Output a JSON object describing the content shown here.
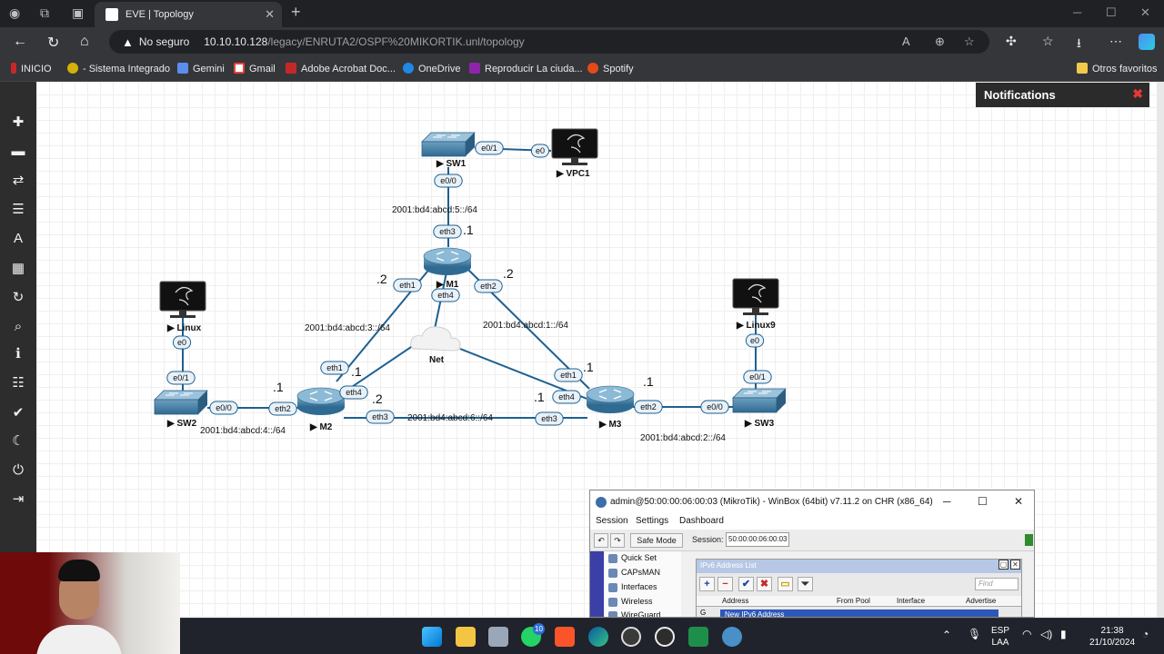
{
  "browser": {
    "tab_title": "EVE | Topology",
    "url_insecure": "No seguro",
    "url_host": "10.10.10.128",
    "url_path": "/legacy/ENRUTA2/OSPF%20MIKORTIK.unl/topology",
    "bookmarks": [
      "INICIO",
      "- Sistema Integrado",
      "Gemini",
      "Gmail",
      "Adobe Acrobat Doc...",
      "OneDrive",
      "Reproducir La ciuda...",
      "Spotify"
    ],
    "other_favorites": "Otros favoritos"
  },
  "notifications": {
    "title": "Notifications"
  },
  "topology": {
    "nodes": {
      "sw1": "SW1",
      "vpc1": "VPC1",
      "m1": "M1",
      "m2": "M2",
      "m3": "M3",
      "sw2": "SW2",
      "sw3": "SW3",
      "linux": "Linux",
      "linux9": "Linux9",
      "net": "Net"
    },
    "ports": {
      "sw1_e01": "e0/1",
      "vpc1_e0": "e0",
      "sw1_e00": "e0/0",
      "m1_eth3": "eth3",
      "m1_eth1": "eth1",
      "m1_eth4": "eth4",
      "m1_eth2": "eth2",
      "m2_eth1": "eth1",
      "m2_eth4": "eth4",
      "m2_eth2": "eth2",
      "m2_eth3": "eth3",
      "m3_eth1": "eth1",
      "m3_eth4": "eth4",
      "m3_eth2": "eth2",
      "m3_eth3": "eth3",
      "linux_e0": "e0",
      "sw2_e01": "e0/1",
      "sw2_e00": "e0/0",
      "linux9_e0": "e0",
      "sw3_e01": "e0/1",
      "sw3_e00": "e0/0"
    },
    "networks": {
      "net5": "2001:bd4:abcd:5::/64",
      "net3": "2001:bd4:abcd:3::/64",
      "net1": "2001:bd4:abcd:1::/64",
      "net4": "2001:bd4:abcd:4::/64",
      "net6": "2001:bd4:abcd:6::/64",
      "net2": "2001:bd4:abcd:2::/64"
    },
    "host_ids": {
      "m1_eth3": ".1",
      "m1_eth1": ".2",
      "m1_eth2": ".2",
      "m2_eth2": ".1",
      "m2_eth1": ".1",
      "m2_eth3": ".2",
      "m3_eth1": ".1",
      "m3_eth2": ".1",
      "m3_eth3": ".1"
    }
  },
  "winbox": {
    "title": "admin@50:00:00:06:00:03 (MikroTik) - WinBox (64bit) v7.11.2 on CHR (x86_64)",
    "menu": [
      "Session",
      "Settings",
      "Dashboard"
    ],
    "safe_mode": "Safe Mode",
    "session_label": "Session:",
    "session_value": "50:00:00:06:00:03",
    "nav": [
      "Quick Set",
      "CAPsMAN",
      "Interfaces",
      "Wireless",
      "WireGuard"
    ],
    "ipv6_list_title": "IPv6 Address List",
    "find_placeholder": "Find",
    "columns": [
      "Address",
      "From Pool",
      "Interface",
      "Advertise"
    ],
    "row_flag": "G",
    "subwindow_title": "New IPv6 Address"
  },
  "taskbar": {
    "lang_top": "ESP",
    "lang_bottom": "LAA",
    "time": "21:38",
    "date": "21/10/2024",
    "whatsapp_badge": "10"
  }
}
